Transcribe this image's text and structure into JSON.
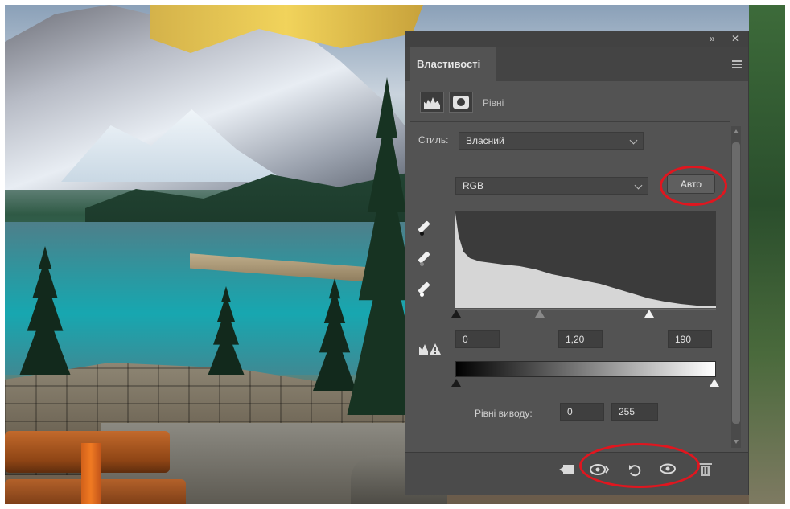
{
  "panel": {
    "tab_title": "Властивості",
    "adjustment_name": "Рівні",
    "preset_label": "Стиль:",
    "preset_value": "Власний",
    "channel_value": "RGB",
    "auto_label": "Авто",
    "input_levels": {
      "black": "0",
      "gamma": "1,20",
      "white": "190"
    },
    "output_label": "Рівні виводу:",
    "output_levels": {
      "black": "0",
      "white": "255"
    }
  },
  "icons": {
    "tab_menu": "menu-icon",
    "histogram_tab": "histogram-icon",
    "mask_tab": "mask-icon",
    "eyedroppers": [
      "black-eyedropper-icon",
      "gray-eyedropper-icon",
      "white-eyedropper-icon"
    ],
    "clipping_warning": "clipping-warning-icon",
    "bottom": [
      "clip-to-layer-icon",
      "view-previous-state-icon",
      "reset-icon",
      "visibility-eye-icon",
      "trash-icon"
    ]
  },
  "colors": {
    "panel_bg": "#535353",
    "highlight_ring": "#e0161f"
  }
}
